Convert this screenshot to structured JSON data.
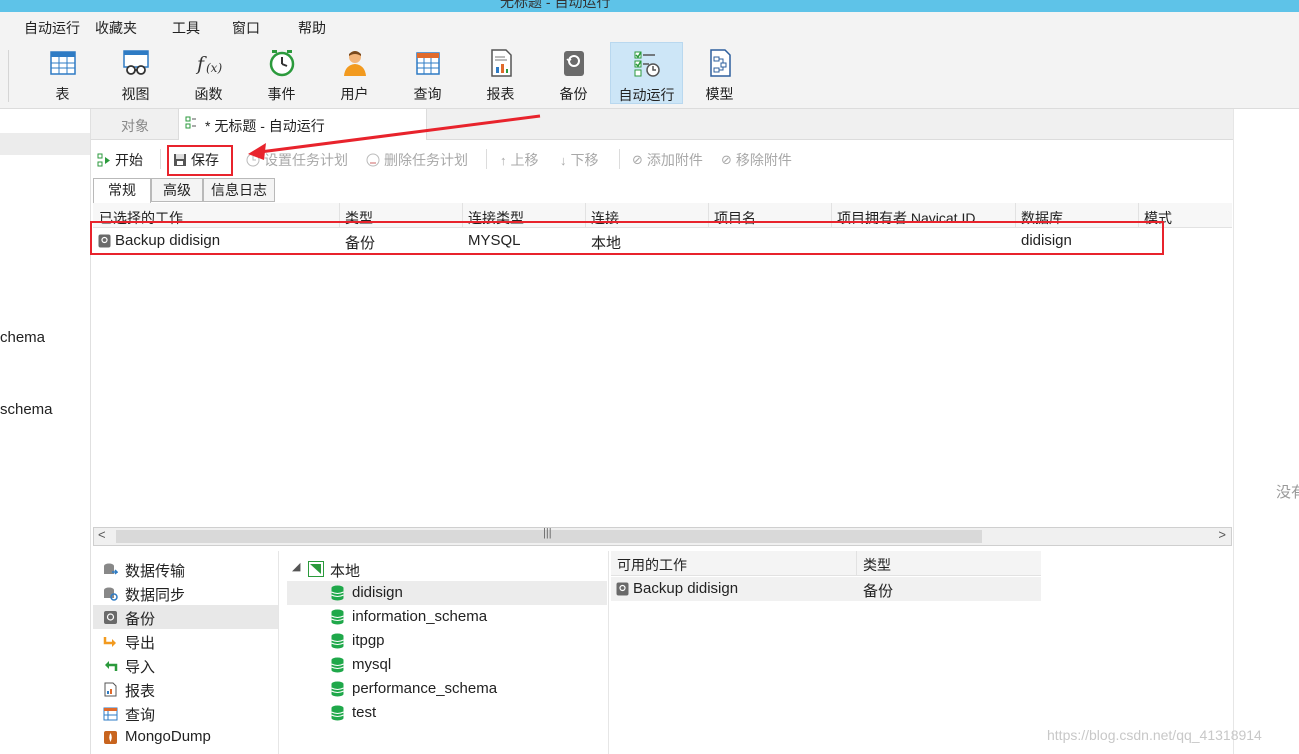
{
  "window": {
    "title": "无标题 - 自动运行"
  },
  "menu": [
    "自动运行",
    "收藏夹",
    "工具",
    "窗口",
    "帮助"
  ],
  "ribbon": [
    {
      "label": "表",
      "icon": "table-icon"
    },
    {
      "label": "视图",
      "icon": "view-icon"
    },
    {
      "label": "函数",
      "icon": "function-icon"
    },
    {
      "label": "事件",
      "icon": "event-clock-icon"
    },
    {
      "label": "用户",
      "icon": "user-icon"
    },
    {
      "label": "查询",
      "icon": "query-icon"
    },
    {
      "label": "报表",
      "icon": "report-icon"
    },
    {
      "label": "备份",
      "icon": "backup-icon"
    },
    {
      "label": "自动运行",
      "icon": "automation-icon",
      "active": true
    },
    {
      "label": "模型",
      "icon": "model-icon"
    }
  ],
  "left_tree_fragments": [
    "chema",
    "schema"
  ],
  "tabs": {
    "objects": "对象",
    "document": "* 无标题 - 自动运行"
  },
  "toolbar": {
    "start": "开始",
    "save": "保存",
    "set_schedule": "设置任务计划",
    "delete_schedule": "删除任务计划",
    "move_up": "上移",
    "move_down": "下移",
    "add_attachment": "添加附件",
    "remove_attachment": "移除附件"
  },
  "subtabs": [
    "常规",
    "高级",
    "信息日志"
  ],
  "grid": {
    "columns": [
      "已选择的工作",
      "类型",
      "连接类型",
      "连接",
      "项目名",
      "项目拥有者 Navicat ID",
      "数据库",
      "模式"
    ],
    "rows": [
      {
        "job": "Backup didisign",
        "type": "备份",
        "conn_type": "MYSQL",
        "conn": "本地",
        "project": "",
        "owner": "",
        "database": "didisign",
        "schema": ""
      }
    ]
  },
  "job_types": [
    {
      "label": "数据传输",
      "icon": "data-transfer-icon"
    },
    {
      "label": "数据同步",
      "icon": "data-sync-icon"
    },
    {
      "label": "备份",
      "icon": "backup-icon",
      "selected": true
    },
    {
      "label": "导出",
      "icon": "export-icon"
    },
    {
      "label": "导入",
      "icon": "import-icon"
    },
    {
      "label": "报表",
      "icon": "report-icon"
    },
    {
      "label": "查询",
      "icon": "query-icon"
    },
    {
      "label": "MongoDump",
      "icon": "mongodump-icon"
    }
  ],
  "connection_tree": {
    "root": "本地",
    "databases": [
      "didisign",
      "information_schema",
      "itpgp",
      "mysql",
      "performance_schema",
      "test"
    ],
    "selected": "didisign"
  },
  "available_jobs": {
    "columns": [
      "可用的工作",
      "类型"
    ],
    "rows": [
      {
        "job": "Backup didisign",
        "type": "备份"
      }
    ]
  },
  "right_panel": {
    "text": "没有"
  },
  "watermark": "https://blog.csdn.net/qq_41318914",
  "colors": {
    "accent_red": "#e8232c",
    "active_blue": "#cde6f7",
    "db_green": "#1fa84a"
  }
}
